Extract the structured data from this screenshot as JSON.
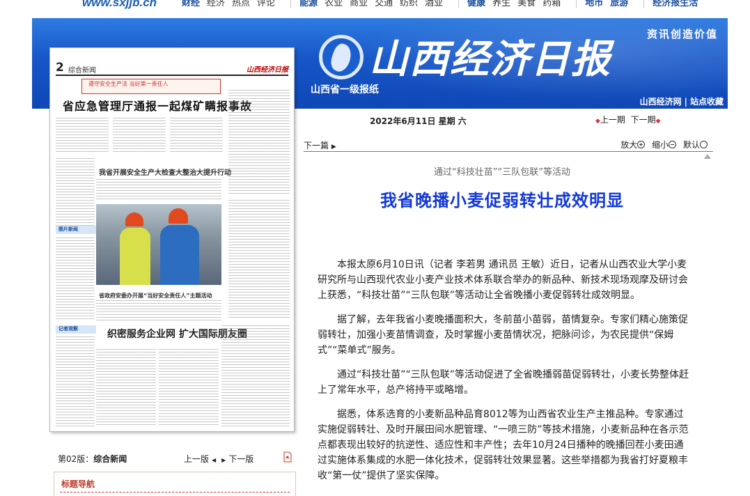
{
  "topbar": {
    "site_url": "www.sxjjb.cn",
    "nav_items": [
      "财经",
      "经济",
      "热点",
      "评论",
      "能源",
      "农业",
      "商业",
      "交通",
      "纺织",
      "酒业",
      "健康",
      "养生",
      "美食",
      "药箱",
      "地市",
      "旅游",
      "经济报生活"
    ]
  },
  "banner": {
    "title": "山西经济日报",
    "slogan": "资讯创造价值",
    "subtitle": "山西省一级报纸",
    "link_site": "山西经济网",
    "link_nav": "站点收藏",
    "separator": "|"
  },
  "paper": {
    "page_num": "2",
    "section": "综合新闻",
    "masthead": "山西经济日报",
    "red_banner": "遵守安全生产法 当好第一责任人",
    "headline_1": "省应急管理厅通报一起煤矿瞒报事故",
    "headline_1b": "我省开展安全生产大检查大整治大提升行动",
    "headline_2": "织密服务企业网 扩大国际朋友圈",
    "headline_3": "省政府安委办开展“当好安全责任人”主题活动",
    "side_labels": [
      "图片新闻",
      "记者观察"
    ]
  },
  "issue": {
    "date": "2022年6月11日 星期 六",
    "prev_issue": "上一期",
    "next_issue": "下一期"
  },
  "toolbar": {
    "next_article": "下一篇",
    "zoom_in": "放大",
    "zoom_out": "缩小",
    "zoom_default": "默认"
  },
  "article": {
    "kicker": "通过“科技壮苗”“三队包联”等活动",
    "headline": "我省晚播小麦促弱转壮成效明显",
    "paragraphs": [
      "本报太原6月10日讯（记者 李若男 通讯员 王敏）近日，记者从山西农业大学小麦研究所与山西现代农业小麦产业技术体系联合举办的新品种、新技术现场观摩及研讨会上获悉，“科技壮苗”“三队包联”等活动让全省晚播小麦促弱转壮成效明显。",
      "据了解，去年我省小麦晚播面积大，冬前苗小苗弱，苗情复杂。专家们精心施策促弱转壮，加强小麦苗情调查，及时掌握小麦苗情状况，把脉问诊，为农民提供“保姆式”“菜单式”服务。",
      "通过“科技壮苗”“三队包联”等活动促进了全省晚播弱苗促弱转壮，小麦长势整体赶上了常年水平，总产将持平或略增。",
      "据悉，体系选育的小麦新品种品育8012等为山西省农业生产主推品种。专家通过实施促弱转壮、及时开展田间水肥管理、“一喷三防”等技术措施，小麦新品种在各示范点都表现出较好的抗逆性、适应性和丰产性；去年10月24日播种的晚播回茬小麦田通过实施体系集成的水肥一体化技术，促弱转壮效果显著。这些举措都为我省打好夏粮丰收“第一仗”提供了坚实保障。"
    ]
  },
  "page_footer": {
    "page_prefix": "第02版：",
    "page_name": "综合新闻",
    "prev_page": "上一版",
    "next_page": "下一版",
    "nav_title": "标题导航"
  },
  "colors": {
    "banner_blue": "#1656c8",
    "headline_blue": "#1238d6",
    "nav_red": "#c0392b"
  }
}
